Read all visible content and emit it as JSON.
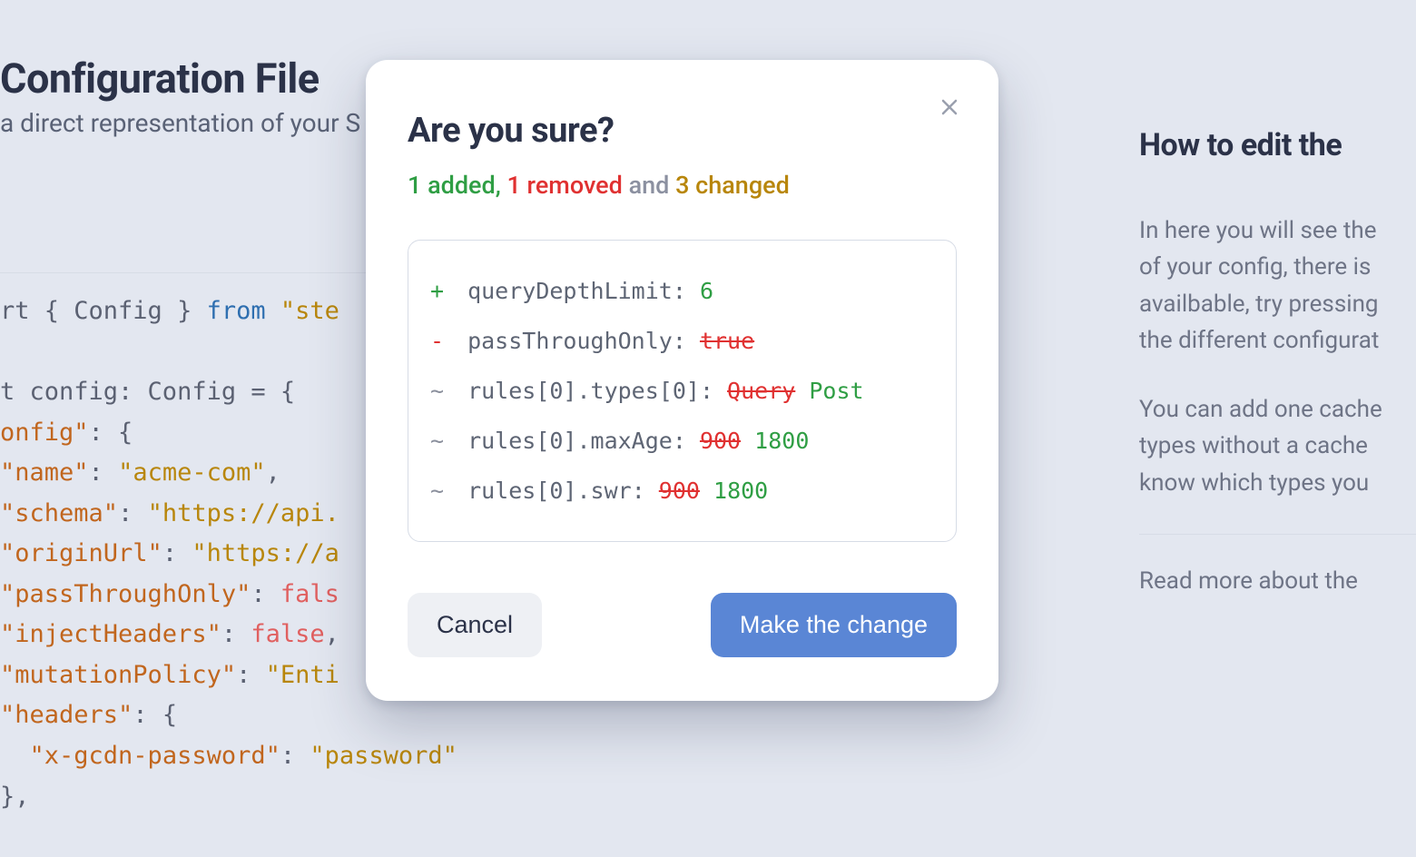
{
  "background": {
    "left": {
      "title_fragment": "Configuration File",
      "subtitle_fragment": "a direct representation of your S",
      "code": {
        "line_import_prefix": "rt { ",
        "line_import_symbol": "Config",
        "line_import_mid": " } ",
        "line_import_from": "from",
        "line_import_str": " \"ste",
        "line_const1": "t config: Config = {",
        "open_onfig": "onfig\"",
        "name_key": "\"name\"",
        "name_val": "\"acme-com\"",
        "schema_key": "\"schema\"",
        "schema_val": "\"https://api.",
        "origin_key": "\"originUrl\"",
        "origin_val": "\"https://a",
        "pto_key": "\"passThroughOnly\"",
        "pto_val": "fals",
        "inj_key": "\"injectHeaders\"",
        "inj_val": "false",
        "mp_key": "\"mutationPolicy\"",
        "mp_val": "\"Enti",
        "hdr_key": "\"headers\"",
        "xgcdn_key": "\"x-gcdn-password\"",
        "xgcdn_val": "\"password\"",
        "close_brace": "},"
      }
    },
    "right": {
      "heading_fragment": "How to edit the",
      "p1_l1": "In here you will see the",
      "p1_l2": "of your config, there is ",
      "p1_l3": "availbable, try pressing",
      "p1_l4": "the different configurat",
      "p2_l1": "You can add one cache",
      "p2_l2": "types without a cache ",
      "p2_l3": "know which types you ",
      "readmore": "Read more about the "
    }
  },
  "modal": {
    "title": "Are you sure?",
    "summary": {
      "added_n": "1",
      "added_word": " added",
      "sep1": ", ",
      "removed_n": "1",
      "removed_word": " removed",
      "and": " and ",
      "changed_n": "3",
      "changed_word": " changed"
    },
    "diff": [
      {
        "sigil": "+",
        "kind": "added",
        "key": "queryDepthLimit",
        "new": "6"
      },
      {
        "sigil": "-",
        "kind": "removed",
        "key": "passThroughOnly",
        "old": "true"
      },
      {
        "sigil": "~",
        "kind": "changed",
        "key": "rules[0].types[0]",
        "old": "Query",
        "new": "Post"
      },
      {
        "sigil": "~",
        "kind": "changed",
        "key": "rules[0].maxAge",
        "old": "900",
        "new": "1800"
      },
      {
        "sigil": "~",
        "kind": "changed",
        "key": "rules[0].swr",
        "old": "900",
        "new": "1800"
      }
    ],
    "actions": {
      "cancel": "Cancel",
      "confirm": "Make the change"
    }
  }
}
